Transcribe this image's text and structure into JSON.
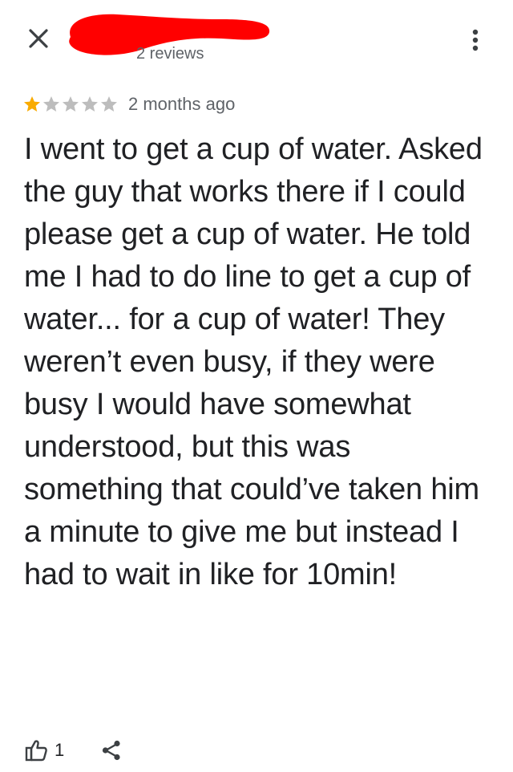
{
  "header": {
    "close_icon": "close-icon",
    "review_count": "2 reviews",
    "more_icon": "more-vert-icon",
    "redaction_color": "#ff0000"
  },
  "review": {
    "rating": 1,
    "rating_max": 5,
    "star_filled_color": "#f9ab00",
    "star_empty_color": "#bdbdbd",
    "age": "2 months ago",
    "text": "I went to get a cup of water. Asked the guy that works there if I could please get a cup of water. He told me I had to do line to get a cup of water... for a cup of water! They weren’t even busy, if they were busy I would have somewhat understood, but this was something that could’ve taken him a minute to give me but instead I had to wait in like for 10min!"
  },
  "actions": {
    "like_icon": "thumb-up-icon",
    "like_count": "1",
    "share_icon": "share-icon"
  }
}
